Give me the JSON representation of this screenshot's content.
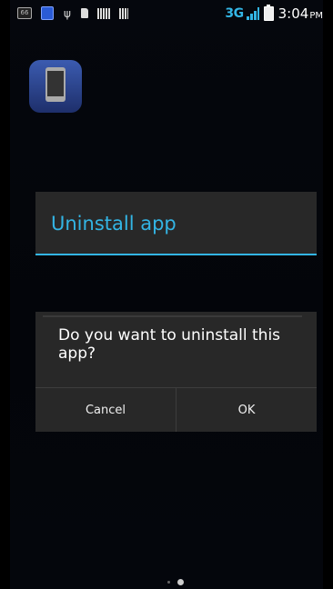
{
  "status_bar": {
    "network_type": "3G",
    "time": "3:04",
    "ampm": "PM",
    "notification_badge": "66",
    "accent_color": "#33b5e5"
  },
  "app_icon": {
    "icon": "phone-charging-icon"
  },
  "panel": {
    "title": "Uninstall app"
  },
  "dialog": {
    "message": "Do you want to uninstall this app?",
    "cancel_label": "Cancel",
    "ok_label": "OK"
  },
  "page_indicator": {
    "count": 2,
    "active_index": 1
  }
}
